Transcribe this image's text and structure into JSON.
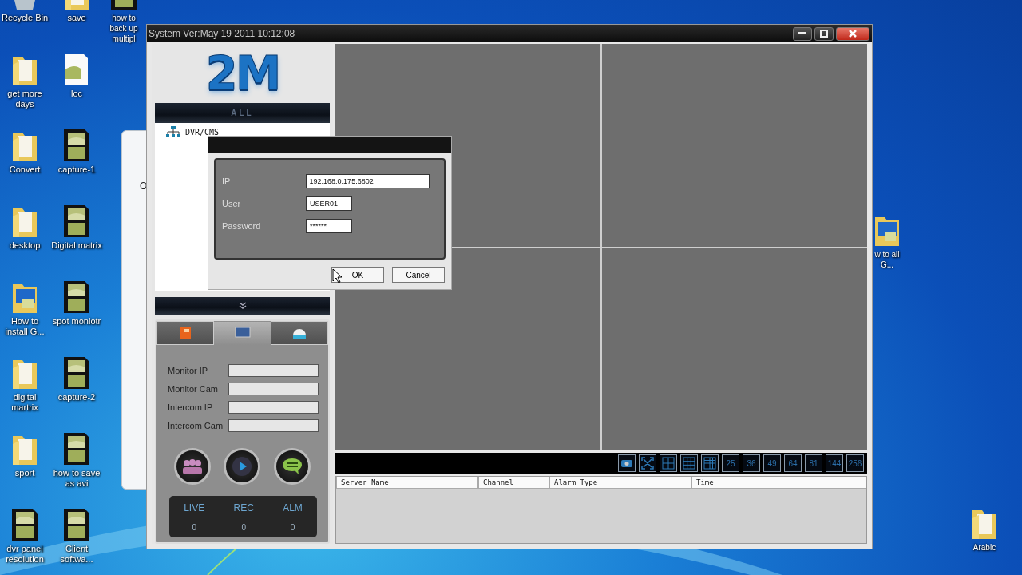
{
  "desktop": {
    "columns": [
      [
        {
          "label": "Recycle Bin",
          "kind": "bin"
        },
        {
          "label": "get more days",
          "kind": "folder"
        },
        {
          "label": "Convert",
          "kind": "folder"
        },
        {
          "label": "desktop",
          "kind": "folder"
        },
        {
          "label": "How to install G...",
          "kind": "shortcut"
        },
        {
          "label": "digital martrix",
          "kind": "folder"
        },
        {
          "label": "sport",
          "kind": "folder"
        },
        {
          "label": "dvr panel resolution",
          "kind": "video"
        }
      ],
      [
        {
          "label": "save",
          "kind": "folder"
        },
        {
          "label": "loc",
          "kind": "document"
        },
        {
          "label": "capture-1",
          "kind": "video"
        },
        {
          "label": "Digital matrix",
          "kind": "video"
        },
        {
          "label": "spot moniotr",
          "kind": "video"
        },
        {
          "label": "capture-2",
          "kind": "video"
        },
        {
          "label": "how to save as avi",
          "kind": "video"
        },
        {
          "label": "Client softwa...",
          "kind": "video"
        }
      ],
      [
        {
          "label": "how to back up multipl",
          "kind": "video"
        }
      ]
    ],
    "right_icons": [
      {
        "label": "w to all G...",
        "kind": "shortcut"
      },
      {
        "label": "Arabic",
        "kind": "folder"
      }
    ],
    "behind_window": {
      "text": "O"
    }
  },
  "window": {
    "title": "System Ver:May 19 2011 10:12:08",
    "logo": "2M",
    "group_header": "ALL",
    "tree": [
      {
        "label": "DVR/CMS"
      }
    ],
    "panel_tabs": [
      {
        "kind": "book",
        "selected": false
      },
      {
        "kind": "monitor",
        "selected": true
      },
      {
        "kind": "dome",
        "selected": false
      }
    ],
    "fields": [
      {
        "label": "Monitor IP"
      },
      {
        "label": "Monitor Cam"
      },
      {
        "label": "Intercom IP"
      },
      {
        "label": "Intercom Cam"
      }
    ],
    "action_buttons": [
      {
        "kind": "group"
      },
      {
        "kind": "play"
      },
      {
        "kind": "chat"
      }
    ],
    "stats": [
      {
        "label": "LIVE",
        "value": "0"
      },
      {
        "label": "REC",
        "value": "0"
      },
      {
        "label": "ALM",
        "value": "0"
      }
    ],
    "toolbar": [
      {
        "kind": "camera"
      },
      {
        "kind": "fullscreen"
      },
      {
        "kind": "grid4"
      },
      {
        "kind": "grid9"
      },
      {
        "kind": "grid16"
      },
      {
        "kind": "text",
        "label": "25"
      },
      {
        "kind": "text",
        "label": "36"
      },
      {
        "kind": "text",
        "label": "49"
      },
      {
        "kind": "text",
        "label": "64"
      },
      {
        "kind": "text",
        "label": "81"
      },
      {
        "kind": "text",
        "label": "144"
      },
      {
        "kind": "text",
        "label": "256"
      }
    ],
    "table": {
      "columns": [
        "Server Name",
        "Channel",
        "Alarm Type",
        "Time"
      ]
    }
  },
  "dialog": {
    "fields": [
      {
        "label": "IP",
        "value": "192.168.0.175:6802"
      },
      {
        "label": "User",
        "value": "USER01"
      },
      {
        "label": "Password",
        "value": "******"
      }
    ],
    "buttons": [
      "OK",
      "Cancel"
    ]
  }
}
